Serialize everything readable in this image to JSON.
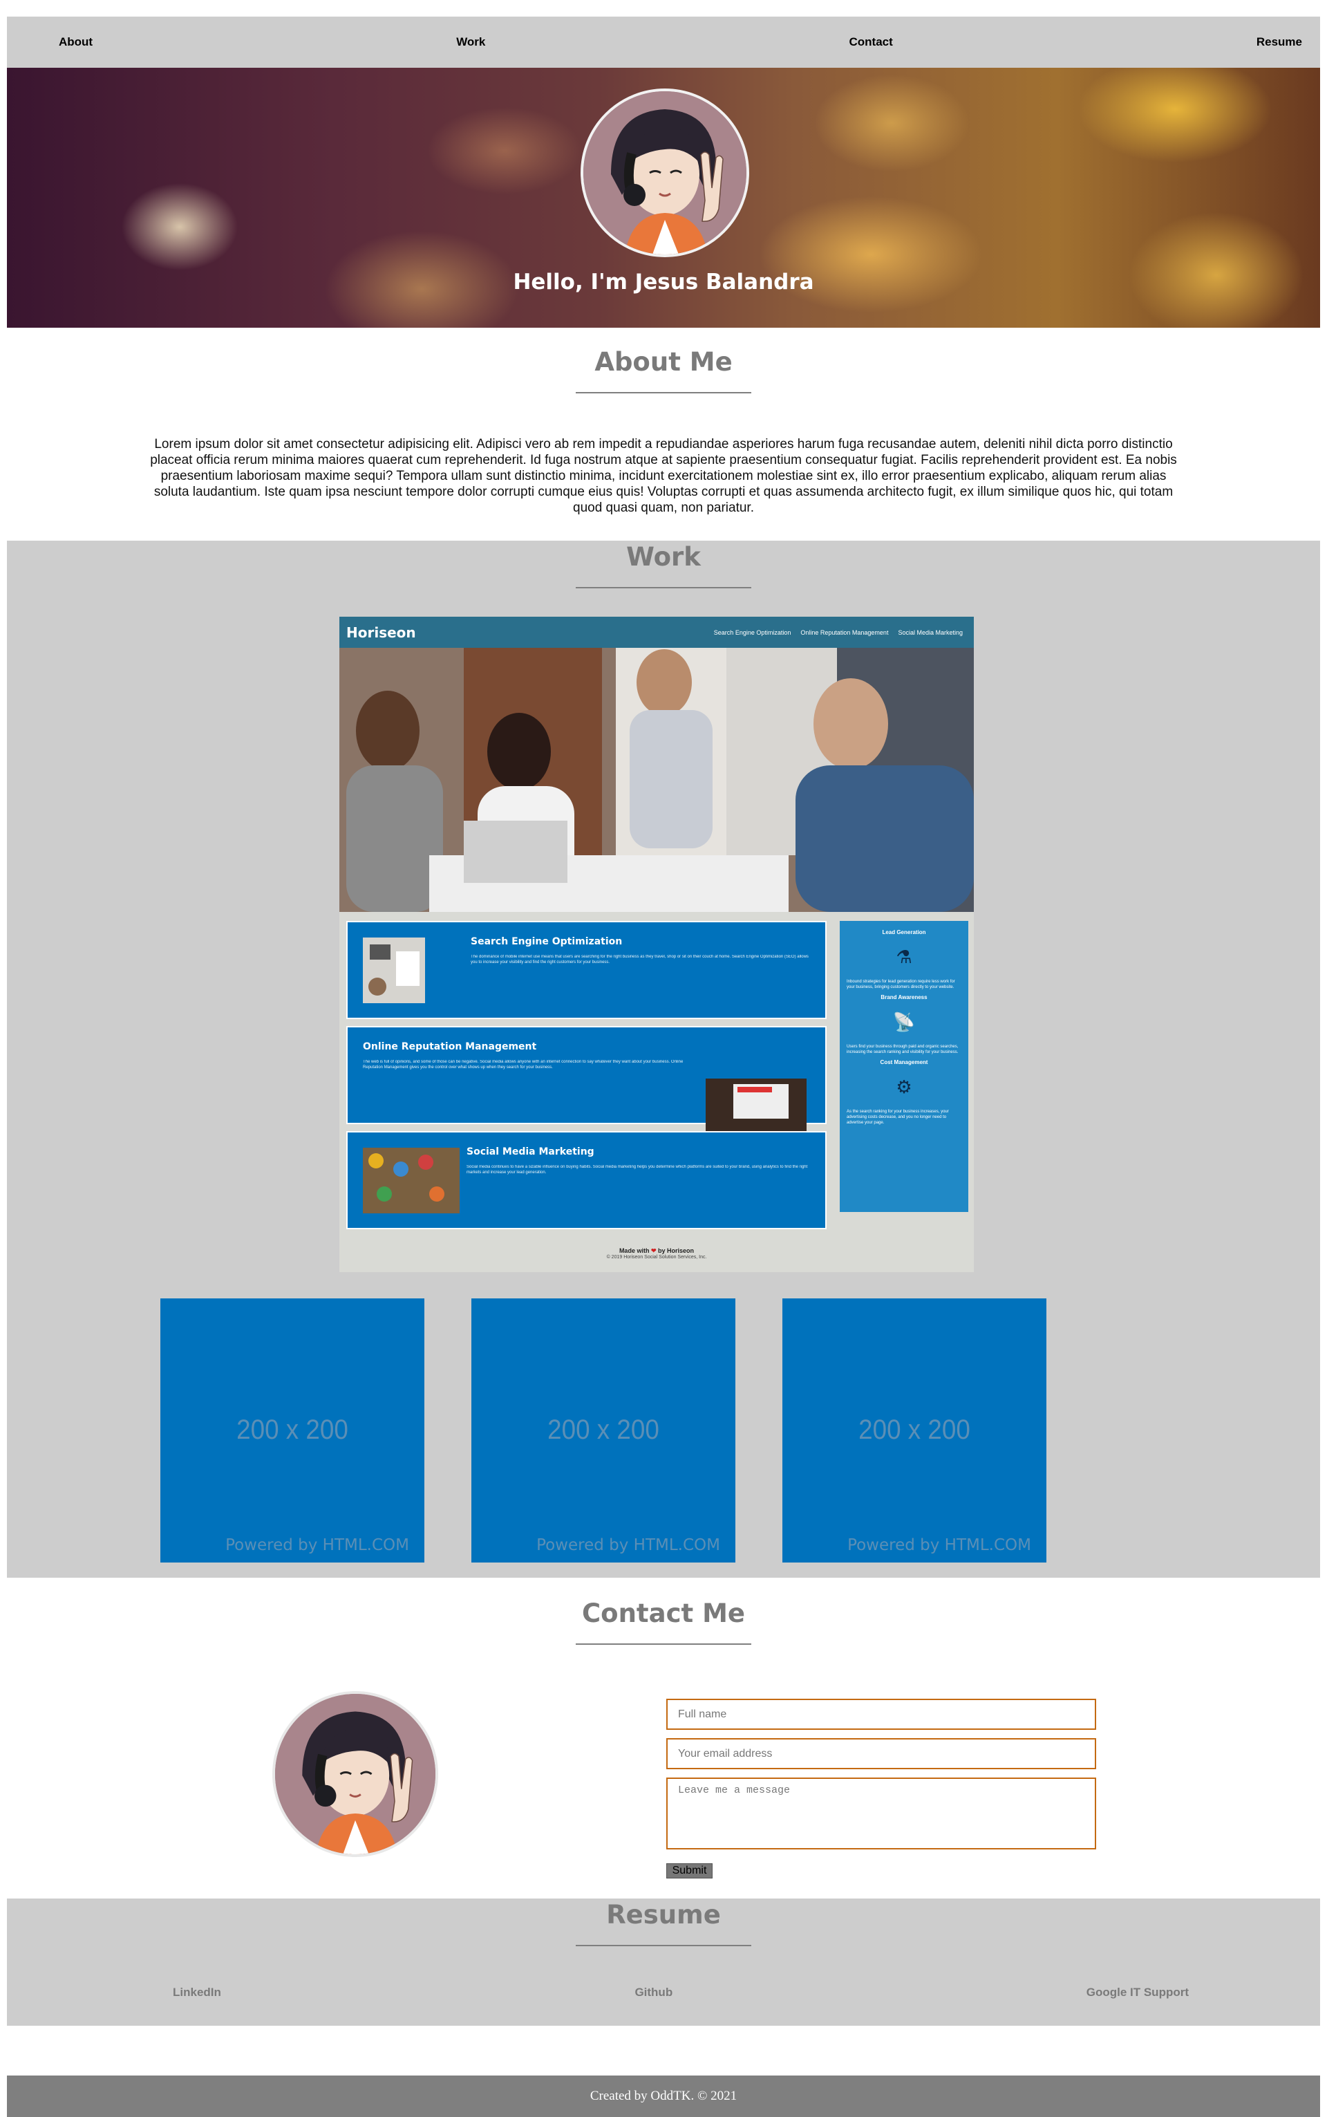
{
  "nav": {
    "about": "About",
    "work": "Work",
    "contact": "Contact",
    "resume": "Resume"
  },
  "hero": {
    "title": "Hello, I'm Jesus Balandra"
  },
  "about": {
    "heading": "About Me",
    "text": "Lorem ipsum dolor sit amet consectetur adipisicing elit. Adipisci vero ab rem impedit a repudiandae asperiores harum fuga recusandae autem, deleniti nihil dicta porro distinctio placeat officia rerum minima maiores quaerat cum reprehenderit. Id fuga nostrum atque at sapiente praesentium consequatur fugiat. Facilis reprehenderit provident est. Ea nobis praesentium laboriosam maxime sequi? Tempora ullam sunt distinctio minima, incidunt exercitationem molestiae sint ex, illo error praesentium explicabo, aliquam rerum alias soluta laudantium. Iste quam ipsa nesciunt tempore dolor corrupti cumque eius quis! Voluptas corrupti et quas assumenda architecto fugit, ex illum similique quos hic, qui totam quod quasi quam, non pariatur."
  },
  "work": {
    "heading": "Work",
    "project": {
      "logo": "Horiseon",
      "links": [
        "Search Engine Optimization",
        "Online Reputation Management",
        "Social Media Marketing"
      ],
      "cards": [
        {
          "title": "Search Engine Optimization",
          "text": "The dominance of mobile internet use means that users are searching for the right business as they travel, shop or sit on their couch at home. Search Engine Optimization (SEO) allows you to increase your visibility and find the right customers for your business."
        },
        {
          "title": "Online Reputation Management",
          "text": "The web is full of opinions, and some of those can be negative. Social media allows anyone with an internet connection to say whatever they want about your business. Online Reputation Management gives you the control over what shows up when they search for your business."
        },
        {
          "title": "Social Media Marketing",
          "text": "Social media continues to have a sizable influence on buying habits. Social media marketing helps you determine which platforms are suited to your brand, using analytics to find the right markets and increase your lead generation."
        }
      ],
      "aside": [
        {
          "title": "Lead Generation",
          "text": "Inbound strategies for lead generation require less work for your business, bringing customers directly to your website."
        },
        {
          "title": "Brand Awareness",
          "text": "Users find your business through paid and organic searches, increasing the search ranking and visibility for your business."
        },
        {
          "title": "Cost Management",
          "text": "As the search ranking for your business increases, your advertising costs decrease, and you no longer need to advertise your page."
        }
      ],
      "footer_made": "Made with",
      "footer_by": "by Horiseon",
      "footer_copy": "© 2019 Horiseon Social Solution Services, Inc."
    },
    "placeholders": [
      {
        "dim": "200 x 200",
        "powered": "Powered by HTML.COM"
      },
      {
        "dim": "200 x 200",
        "powered": "Powered by HTML.COM"
      },
      {
        "dim": "200 x 200",
        "powered": "Powered by HTML.COM"
      }
    ]
  },
  "contact": {
    "heading": "Contact Me",
    "name_placeholder": "Full name",
    "email_placeholder": "Your email address",
    "message_placeholder": "Leave me a message",
    "submit": "Submit"
  },
  "resume": {
    "heading": "Resume",
    "links": [
      "LinkedIn",
      "Github",
      "Google IT Support"
    ]
  },
  "footer": {
    "text": "Created by OddTK. © 2021"
  },
  "colors": {
    "nav_bg": "#cdcdcd",
    "heading": "#7a7a7a",
    "placeholder_blue": "#0072bc",
    "input_border": "#c46a12",
    "footer_bg": "#7f7f7f"
  }
}
